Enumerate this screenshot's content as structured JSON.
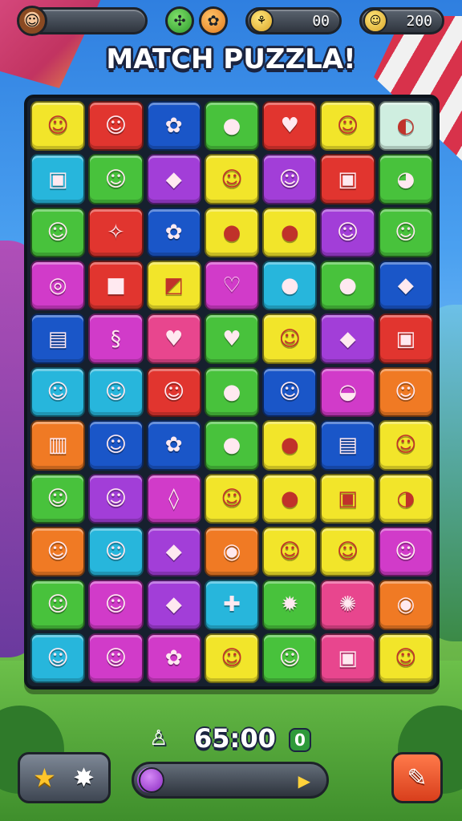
{
  "header": {
    "avatar_icon": "boy-face-icon",
    "avatar_glyph": "☺",
    "green_button_icon": "clover-icon",
    "green_button_glyph": "✣",
    "orange_button_icon": "flower-icon",
    "orange_button_glyph": "✿",
    "currency_icon": "bow-icon",
    "currency_glyph": "⚘",
    "currency_value": "00",
    "coin_icon": "smiley-coin-icon",
    "coin_glyph": "☺",
    "coin_value": "200"
  },
  "title": "MATCH PUZZLA!",
  "board": {
    "columns": 7,
    "rows": 11,
    "tiles": [
      {
        "icon": "face",
        "glyph": "☺",
        "color": "yellow"
      },
      {
        "icon": "face",
        "glyph": "☺",
        "color": "red"
      },
      {
        "icon": "flower",
        "glyph": "✿",
        "color": "blue"
      },
      {
        "icon": "apple",
        "glyph": "●",
        "color": "green"
      },
      {
        "icon": "heart",
        "glyph": "♥",
        "color": "red"
      },
      {
        "icon": "face",
        "glyph": "☺",
        "color": "yellow"
      },
      {
        "icon": "capsule",
        "glyph": "◐",
        "color": "pale"
      },
      {
        "icon": "box",
        "glyph": "▣",
        "color": "cyan"
      },
      {
        "icon": "face",
        "glyph": "☺",
        "color": "green"
      },
      {
        "icon": "gem",
        "glyph": "◆",
        "color": "purple"
      },
      {
        "icon": "face",
        "glyph": "☺",
        "color": "yellow"
      },
      {
        "icon": "face",
        "glyph": "☺",
        "color": "purple"
      },
      {
        "icon": "box",
        "glyph": "▣",
        "color": "red"
      },
      {
        "icon": "speech-bubble",
        "glyph": "◕",
        "color": "green"
      },
      {
        "icon": "face",
        "glyph": "☺",
        "color": "green"
      },
      {
        "icon": "twig",
        "glyph": "✧",
        "color": "red"
      },
      {
        "icon": "flower",
        "glyph": "✿",
        "color": "blue"
      },
      {
        "icon": "apple",
        "glyph": "●",
        "color": "yellow"
      },
      {
        "icon": "apple",
        "glyph": "●",
        "color": "yellow"
      },
      {
        "icon": "face",
        "glyph": "☺",
        "color": "purple"
      },
      {
        "icon": "face",
        "glyph": "☺",
        "color": "green"
      },
      {
        "icon": "ring",
        "glyph": "◎",
        "color": "magenta"
      },
      {
        "icon": "cube",
        "glyph": "■",
        "color": "red"
      },
      {
        "icon": "cake",
        "glyph": "◩",
        "color": "yellow"
      },
      {
        "icon": "heart",
        "glyph": "♡",
        "color": "magenta"
      },
      {
        "icon": "apple",
        "glyph": "●",
        "color": "cyan"
      },
      {
        "icon": "apple",
        "glyph": "●",
        "color": "green"
      },
      {
        "icon": "diamond",
        "glyph": "◆",
        "color": "blue"
      },
      {
        "icon": "bag",
        "glyph": "▤",
        "color": "blue"
      },
      {
        "icon": "paperclip",
        "glyph": "§",
        "color": "magenta"
      },
      {
        "icon": "heart",
        "glyph": "♥",
        "color": "pink"
      },
      {
        "icon": "heart",
        "glyph": "♥",
        "color": "green"
      },
      {
        "icon": "face",
        "glyph": "☺",
        "color": "yellow"
      },
      {
        "icon": "eraser",
        "glyph": "◆",
        "color": "purple"
      },
      {
        "icon": "robot",
        "glyph": "▣",
        "color": "red"
      },
      {
        "icon": "face",
        "glyph": "☺",
        "color": "cyan"
      },
      {
        "icon": "face",
        "glyph": "☺",
        "color": "cyan"
      },
      {
        "icon": "face",
        "glyph": "☺",
        "color": "red"
      },
      {
        "icon": "apple",
        "glyph": "●",
        "color": "green"
      },
      {
        "icon": "face",
        "glyph": "☺",
        "color": "blue"
      },
      {
        "icon": "eraser",
        "glyph": "◒",
        "color": "magenta"
      },
      {
        "icon": "face",
        "glyph": "☺",
        "color": "orange"
      },
      {
        "icon": "jar",
        "glyph": "▥",
        "color": "orange"
      },
      {
        "icon": "face",
        "glyph": "☺",
        "color": "blue"
      },
      {
        "icon": "flower",
        "glyph": "✿",
        "color": "blue"
      },
      {
        "icon": "apple",
        "glyph": "●",
        "color": "green"
      },
      {
        "icon": "apple",
        "glyph": "●",
        "color": "yellow"
      },
      {
        "icon": "note",
        "glyph": "▤",
        "color": "blue"
      },
      {
        "icon": "face",
        "glyph": "☺",
        "color": "yellow"
      },
      {
        "icon": "face",
        "glyph": "☺",
        "color": "green"
      },
      {
        "icon": "face",
        "glyph": "☺",
        "color": "purple"
      },
      {
        "icon": "drop",
        "glyph": "◊",
        "color": "magenta"
      },
      {
        "icon": "face",
        "glyph": "☺",
        "color": "yellow"
      },
      {
        "icon": "apple",
        "glyph": "●",
        "color": "yellow"
      },
      {
        "icon": "box",
        "glyph": "▣",
        "color": "yellow"
      },
      {
        "icon": "brush",
        "glyph": "◑",
        "color": "yellow"
      },
      {
        "icon": "face",
        "glyph": "☺",
        "color": "orange"
      },
      {
        "icon": "face",
        "glyph": "☺",
        "color": "cyan"
      },
      {
        "icon": "diamond",
        "glyph": "◆",
        "color": "purple"
      },
      {
        "icon": "monster",
        "glyph": "◉",
        "color": "orange"
      },
      {
        "icon": "face",
        "glyph": "☺",
        "color": "yellow"
      },
      {
        "icon": "face",
        "glyph": "☺",
        "color": "yellow"
      },
      {
        "icon": "face",
        "glyph": "☺",
        "color": "magenta"
      },
      {
        "icon": "face",
        "glyph": "☺",
        "color": "green"
      },
      {
        "icon": "face",
        "glyph": "☺",
        "color": "magenta"
      },
      {
        "icon": "diamond",
        "glyph": "◆",
        "color": "purple"
      },
      {
        "icon": "plus",
        "glyph": "✚",
        "color": "cyan"
      },
      {
        "icon": "star-burst",
        "glyph": "✹",
        "color": "green"
      },
      {
        "icon": "sun",
        "glyph": "✺",
        "color": "pink"
      },
      {
        "icon": "monster",
        "glyph": "◉",
        "color": "orange"
      },
      {
        "icon": "face",
        "glyph": "☺",
        "color": "cyan"
      },
      {
        "icon": "face",
        "glyph": "☺",
        "color": "magenta"
      },
      {
        "icon": "flower",
        "glyph": "✿",
        "color": "magenta"
      },
      {
        "icon": "face",
        "glyph": "☺",
        "color": "yellow"
      },
      {
        "icon": "face",
        "glyph": "☺",
        "color": "green"
      },
      {
        "icon": "box",
        "glyph": "▣",
        "color": "pink"
      },
      {
        "icon": "face",
        "glyph": "☺",
        "color": "yellow"
      }
    ]
  },
  "status": {
    "timer_icon": "person-icon",
    "timer_glyph": "♙",
    "timer": "65:00",
    "moves_badge": "0"
  },
  "bottom": {
    "star_boost_icon": "star-icon",
    "star_glyph": "★",
    "spark_boost_icon": "sparkle-face-icon",
    "spark_glyph": "✸",
    "progress_fraction": 0.08,
    "progress_arrow_glyph": "▶",
    "action_icon": "wrench-icon",
    "action_glyph": "✎"
  },
  "colors": {
    "yellow": "#f2e52a",
    "red": "#e1352f",
    "blue": "#1a56c8",
    "green": "#48c23c",
    "purple": "#a23ed8",
    "magenta": "#d13bc9",
    "cyan": "#27b6dc",
    "orange": "#f07a24",
    "pink": "#e8468e",
    "pale": "#cfeee0"
  }
}
